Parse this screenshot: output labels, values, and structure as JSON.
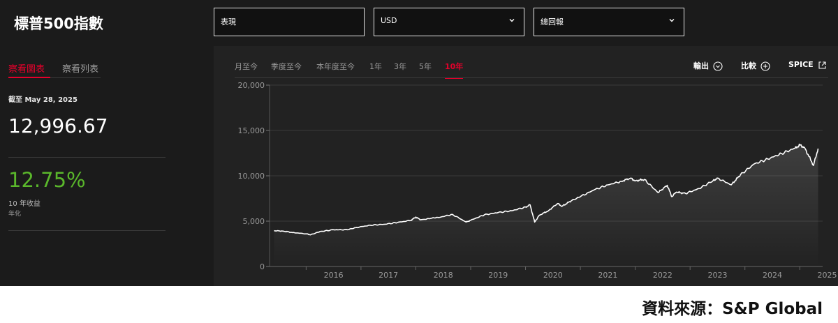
{
  "header": {
    "title": "標普500指數"
  },
  "selects": [
    {
      "value": "表現",
      "has_chevron": false
    },
    {
      "value": "USD",
      "has_chevron": true
    },
    {
      "value": "總回報",
      "has_chevron": true
    }
  ],
  "view_tabs": {
    "chart_label": "察看圖表",
    "list_label": "察看列表",
    "active": "chart"
  },
  "summary": {
    "as_of": "截至 May 28, 2025",
    "value": "12,996.67",
    "return": "12.75%",
    "return_label": "10 年收益",
    "return_sub": "年化",
    "return_color": "#5ab72b"
  },
  "range_tabs": [
    "月至今",
    "季度至今",
    "本年度至今",
    "1年",
    "3年",
    "5年",
    "10年"
  ],
  "active_range": "10年",
  "actions": {
    "export": "輸出",
    "compare": "比較",
    "spice": "SPICE"
  },
  "icons": {
    "export": "chevron-circle-icon",
    "compare": "plus-circle-icon",
    "spice": "external-link-icon"
  },
  "colors": {
    "accent": "#e4002b",
    "positive": "#5ab72b",
    "background": "#1b1b1b",
    "line": "#ffffff"
  },
  "chart_data": {
    "type": "area",
    "x": [
      "2015-06",
      "2015-08",
      "2015-10",
      "2016-01",
      "2016-02",
      "2016-04",
      "2016-07",
      "2016-10",
      "2016-12",
      "2017-03",
      "2017-06",
      "2017-09",
      "2017-12",
      "2018-01",
      "2018-02",
      "2018-06",
      "2018-09",
      "2018-12",
      "2019-01",
      "2019-04",
      "2019-07",
      "2019-10",
      "2020-01",
      "2020-02",
      "2020-03",
      "2020-04",
      "2020-06",
      "2020-08",
      "2020-09",
      "2020-11",
      "2021-01",
      "2021-04",
      "2021-07",
      "2021-10",
      "2021-12",
      "2022-01",
      "2022-03",
      "2022-06",
      "2022-08",
      "2022-09",
      "2022-10",
      "2022-12",
      "2023-03",
      "2023-06",
      "2023-07",
      "2023-10",
      "2023-12",
      "2024-03",
      "2024-06",
      "2024-09",
      "2024-12",
      "2025-01",
      "2025-02",
      "2025-04",
      "2025-05"
    ],
    "values": [
      3950,
      3900,
      3750,
      3600,
      3500,
      3850,
      4050,
      4050,
      4300,
      4550,
      4650,
      4850,
      5100,
      5450,
      5150,
      5400,
      5750,
      4900,
      5100,
      5700,
      5950,
      6150,
      6550,
      6800,
      4900,
      5650,
      6150,
      6950,
      6650,
      7250,
      7700,
      8450,
      9000,
      9400,
      9750,
      9450,
      9600,
      8150,
      8950,
      7700,
      8200,
      8050,
      8600,
      9450,
      9750,
      9000,
      10100,
      11300,
      11850,
      12450,
      13050,
      13400,
      13150,
      11150,
      12997
    ],
    "title": "",
    "xlabel": "",
    "ylabel": "",
    "xticks": [
      "2016",
      "2017",
      "2018",
      "2019",
      "2020",
      "2021",
      "2022",
      "2023",
      "2024",
      "2025"
    ],
    "yticks": [
      "0",
      "5,000",
      "10,000",
      "15,000",
      "20,000"
    ],
    "xlim": [
      "2015-05",
      "2025-06"
    ],
    "ylim": [
      0,
      20000
    ],
    "grid": true
  },
  "footer": {
    "source": "資料來源：S&P Global"
  }
}
